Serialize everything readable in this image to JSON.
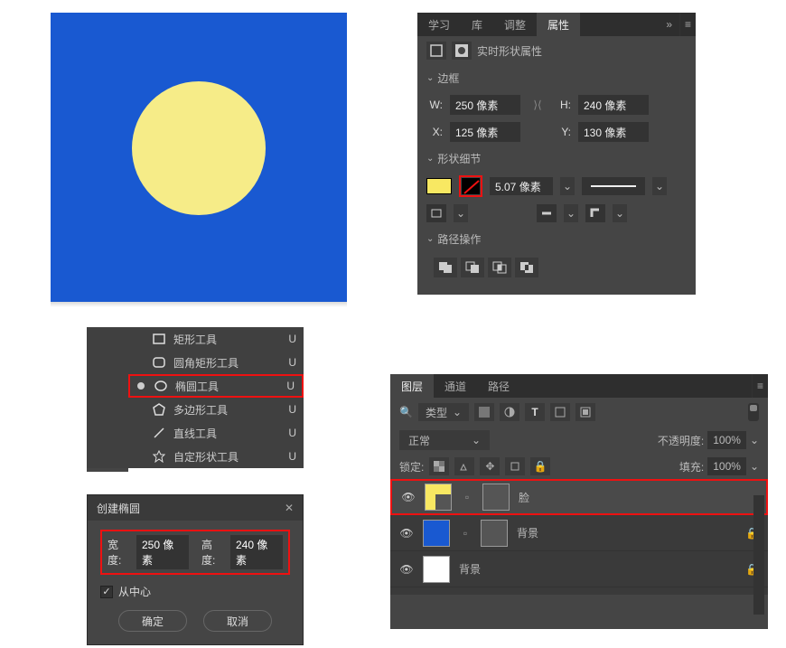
{
  "canvas": {
    "bg": "#1959d1",
    "circle_color": "#f6ec88"
  },
  "properties": {
    "tabs": [
      {
        "label": "学习"
      },
      {
        "label": "库"
      },
      {
        "label": "调整"
      },
      {
        "label": "属性"
      }
    ],
    "live_shape_title": "实时形状属性",
    "section_border": "边框",
    "w_label": "W:",
    "w_value": "250 像素",
    "h_label": "H:",
    "h_value": "240 像素",
    "x_label": "X:",
    "x_value": "125 像素",
    "y_label": "Y:",
    "y_value": "130 像素",
    "section_shape_detail": "形状细节",
    "stroke_value": "5.07 像素",
    "section_path_ops": "路径操作"
  },
  "tool_flyout": {
    "items": [
      {
        "icon": "rect",
        "label": "矩形工具",
        "shortcut": "U"
      },
      {
        "icon": "round-rect",
        "label": "圆角矩形工具",
        "shortcut": "U"
      },
      {
        "icon": "ellipse",
        "label": "椭圆工具",
        "shortcut": "U",
        "selected": true
      },
      {
        "icon": "polygon",
        "label": "多边形工具",
        "shortcut": "U"
      },
      {
        "icon": "line",
        "label": "直线工具",
        "shortcut": "U"
      },
      {
        "icon": "custom",
        "label": "自定形状工具",
        "shortcut": "U"
      }
    ]
  },
  "create_ellipse": {
    "title": "创建椭圆",
    "width_label": "宽度:",
    "width_value": "250 像素",
    "height_label": "高度:",
    "height_value": "240 像素",
    "from_center_label": "从中心",
    "ok_label": "确定",
    "cancel_label": "取消"
  },
  "layers": {
    "tabs": [
      {
        "label": "图层"
      },
      {
        "label": "通道"
      },
      {
        "label": "路径"
      }
    ],
    "filter_label": "类型",
    "blend_mode": "正常",
    "opacity_label": "不透明度:",
    "opacity_value": "100%",
    "lock_label": "锁定:",
    "fill_label": "填充:",
    "fill_value": "100%",
    "items": [
      {
        "name": "脸",
        "thumb_bg": "#f8e862",
        "thumb_overlay": "#555",
        "mask": true,
        "selected": true
      },
      {
        "name": "背景",
        "thumb_bg": "#1959d1",
        "thumb_overlay": "",
        "mask": true,
        "locked": true
      },
      {
        "name": "背景",
        "thumb_bg": "#ffffff",
        "thumb_overlay": "",
        "mask": false,
        "locked": true
      }
    ]
  },
  "chart_data": null
}
